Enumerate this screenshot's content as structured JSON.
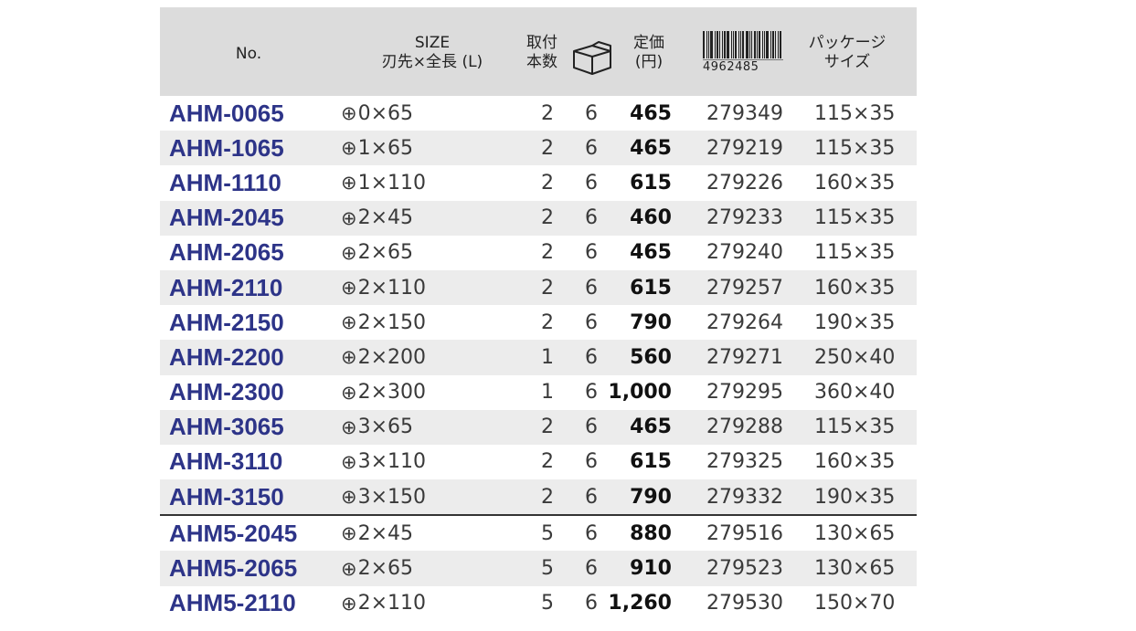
{
  "header": {
    "no": "No.",
    "size_line1": "SIZE",
    "size_line2": "刃先×全長 (L)",
    "qty_line1": "取付",
    "qty_line2": "本数",
    "box_icon": "box-icon",
    "price_line1": "定価",
    "price_line2": "(円)",
    "barcode_icon": "barcode-icon",
    "jan_prefix": "4962485",
    "pkg_line1": "パッケージ",
    "pkg_line2": "サイズ"
  },
  "rows": [
    {
      "no": "AHM-0065",
      "size": "0×65",
      "qty": "2",
      "pack": "6",
      "price": "465",
      "jan": "279349",
      "pkg": "115×35"
    },
    {
      "no": "AHM-1065",
      "size": "1×65",
      "qty": "2",
      "pack": "6",
      "price": "465",
      "jan": "279219",
      "pkg": "115×35"
    },
    {
      "no": "AHM-1110",
      "size": "1×110",
      "qty": "2",
      "pack": "6",
      "price": "615",
      "jan": "279226",
      "pkg": "160×35"
    },
    {
      "no": "AHM-2045",
      "size": "2×45",
      "qty": "2",
      "pack": "6",
      "price": "460",
      "jan": "279233",
      "pkg": "115×35"
    },
    {
      "no": "AHM-2065",
      "size": "2×65",
      "qty": "2",
      "pack": "6",
      "price": "465",
      "jan": "279240",
      "pkg": "115×35"
    },
    {
      "no": "AHM-2110",
      "size": "2×110",
      "qty": "2",
      "pack": "6",
      "price": "615",
      "jan": "279257",
      "pkg": "160×35"
    },
    {
      "no": "AHM-2150",
      "size": "2×150",
      "qty": "2",
      "pack": "6",
      "price": "790",
      "jan": "279264",
      "pkg": "190×35"
    },
    {
      "no": "AHM-2200",
      "size": "2×200",
      "qty": "1",
      "pack": "6",
      "price": "560",
      "jan": "279271",
      "pkg": "250×40"
    },
    {
      "no": "AHM-2300",
      "size": "2×300",
      "qty": "1",
      "pack": "6",
      "price": "1,000",
      "jan": "279295",
      "pkg": "360×40"
    },
    {
      "no": "AHM-3065",
      "size": "3×65",
      "qty": "2",
      "pack": "6",
      "price": "465",
      "jan": "279288",
      "pkg": "115×35"
    },
    {
      "no": "AHM-3110",
      "size": "3×110",
      "qty": "2",
      "pack": "6",
      "price": "615",
      "jan": "279325",
      "pkg": "160×35"
    },
    {
      "no": "AHM-3150",
      "size": "3×150",
      "qty": "2",
      "pack": "6",
      "price": "790",
      "jan": "279332",
      "pkg": "190×35"
    },
    {
      "no": "AHM5-2045",
      "size": "2×45",
      "qty": "5",
      "pack": "6",
      "price": "880",
      "jan": "279516",
      "pkg": "130×65"
    },
    {
      "no": "AHM5-2065",
      "size": "2×65",
      "qty": "5",
      "pack": "6",
      "price": "910",
      "jan": "279523",
      "pkg": "130×65"
    },
    {
      "no": "AHM5-2110",
      "size": "2×110",
      "qty": "5",
      "pack": "6",
      "price": "1,260",
      "jan": "279530",
      "pkg": "150×70"
    }
  ]
}
